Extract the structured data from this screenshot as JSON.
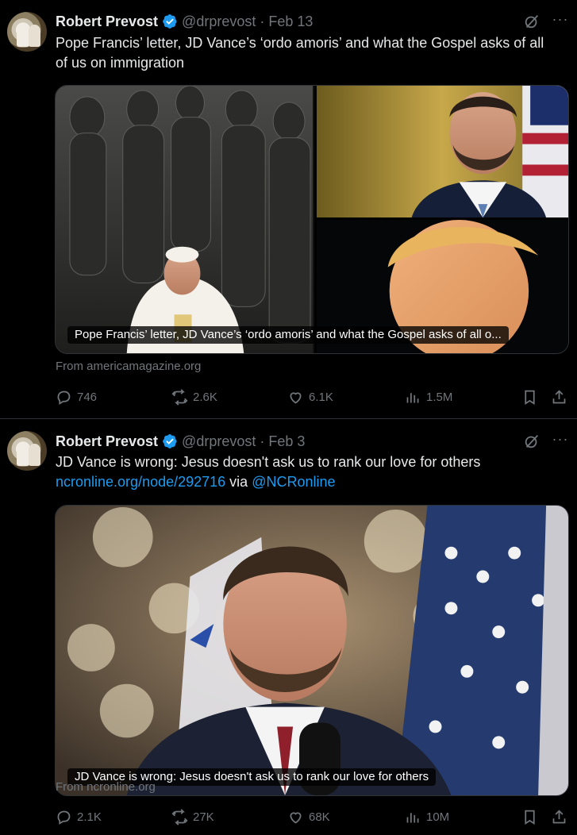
{
  "tweets": [
    {
      "author": "Robert Prevost",
      "handle": "@drprevost",
      "separator": "·",
      "date": "Feb 13",
      "text_plain": "Pope Francis’ letter, JD Vance’s ‘ordo amoris’ and what the Gospel asks of all of us on immigration",
      "card_caption": "Pope Francis’ letter, JD Vance’s ‘ordo amoris’ and what the Gospel asks of all o...",
      "source": "From americamagazine.org",
      "stats": {
        "replies": "746",
        "reposts": "2.6K",
        "likes": "6.1K",
        "views": "1.5M"
      }
    },
    {
      "author": "Robert Prevost",
      "handle": "@drprevost",
      "separator": "·",
      "date": "Feb 3",
      "text_plain": "JD Vance is wrong: Jesus doesn't ask us to rank our love for others",
      "text_link": "ncronline.org/node/292716",
      "text_via": " via ",
      "text_mention": "@NCRonline",
      "card_caption": "JD Vance is wrong: Jesus doesn't ask us to rank our love for others",
      "source": "From ncronline.org",
      "stats": {
        "replies": "2.1K",
        "reposts": "27K",
        "likes": "68K",
        "views": "10M"
      }
    }
  ],
  "icons": {
    "verified": "verified-badge-icon",
    "grok": "grok-icon",
    "more": "more-icon",
    "reply": "reply-icon",
    "repost": "repost-icon",
    "like": "like-icon",
    "views": "views-icon",
    "bookmark": "bookmark-icon",
    "share": "share-icon"
  },
  "colors": {
    "background": "#000000",
    "text": "#e7e9ea",
    "muted": "#71767b",
    "link": "#1d9bf0",
    "verified": "#1d9bf0",
    "border": "#2f3336"
  }
}
